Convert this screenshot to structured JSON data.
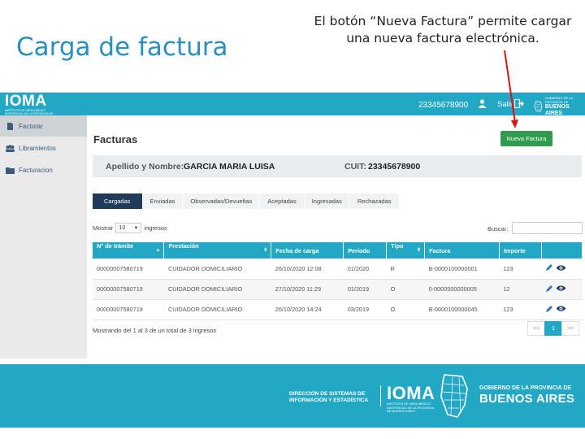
{
  "slide": {
    "title": "Carga de factura",
    "callout": "El botón “Nueva Factura” permite cargar una nueva factura electrónica."
  },
  "app": {
    "brand": "IOMA",
    "brand_sub": "INSTITUTO DE OBRA MÉDICO ASISTENCIAL DE LA PROVINCIA DE BUENOS AIRES",
    "user_id": "23345678900",
    "logout_label": "Salir",
    "gov_small": "GOBIERNO DE LA PROVINCIA DE",
    "gov_big": "BUENOS AIRES",
    "colors": {
      "primary": "#22a7c5",
      "dark_tab": "#203b5a",
      "button": "#2e9c4c",
      "link": "#3a5a80"
    }
  },
  "sidebar": {
    "items": [
      {
        "label": "Facturar",
        "icon": "document-icon"
      },
      {
        "label": "Libramientos",
        "icon": "group-icon"
      },
      {
        "label": "Facturacion",
        "icon": "folder-icon"
      }
    ]
  },
  "main": {
    "page_title": "Facturas",
    "new_button": "Nueva Factura",
    "info": {
      "name_label": "Apellido y Nombre:",
      "name_value": "GARCIA MARIA LUISA",
      "cuit_label": "CUIT:",
      "cuit_value": "23345678900"
    },
    "tabs": [
      "Cargadas",
      "Enviadas",
      "Observadas/Devueltas",
      "Aceptadas",
      "Ingresadas",
      "Rechazadas"
    ],
    "show_label": "Mostrar",
    "page_length": "10",
    "entries_label": "ingresos",
    "search_label": "Buscar:",
    "columns": [
      "N° de trámite",
      "Prestación",
      "Fecha de carga",
      "Periodo",
      "Tipo",
      "Factura",
      "Importe",
      ""
    ],
    "rows": [
      [
        "00000007580719",
        "CUIDADOR DOMICILIARIO",
        "26/10/2020 12:08",
        "01/2020",
        "R",
        "B-0000100000001",
        "123"
      ],
      [
        "00000007580719",
        "CUIDADOR DOMICILIARIO",
        "27/10/2020 11:29",
        "01/2019",
        "O",
        "0-0000500000005",
        "12"
      ],
      [
        "00000007580719",
        "CUIDADOR DOMICILIARIO",
        "26/10/2020 14:24",
        "03/2019",
        "O",
        "B-0000100000045",
        "123"
      ]
    ],
    "summary": "Mostrando del 1 al 3 de un total de 3 ingresos",
    "pager": {
      "prev": "<<",
      "current": "1",
      "next": ">>"
    }
  },
  "footer": {
    "direccion": "DIRECCIÓN DE SISTEMAS DE INFORMACIÓN Y ESTADÍSTICA",
    "ioma": "IOMA",
    "ioma_sub": "INSTITUTO DE OBRA MÉDICO ASISTENCIAL DE LA PROVINCIA DE BUENOS AIRES",
    "gov_small": "GOBIERNO DE LA PROVINCIA DE",
    "gov_big": "BUENOS AIRES"
  }
}
